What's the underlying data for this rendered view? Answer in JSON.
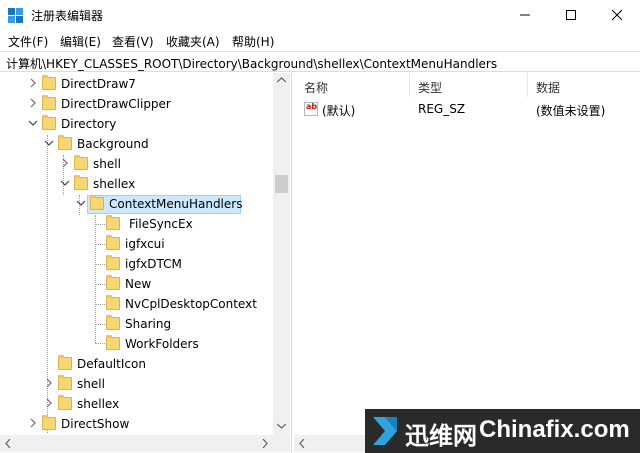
{
  "window": {
    "title": "注册表编辑器",
    "controls": {
      "minimize": "minimize-icon",
      "maximize": "maximize-icon",
      "close": "close-icon"
    }
  },
  "menu": [
    "文件(F)",
    "编辑(E)",
    "查看(V)",
    "收藏夹(A)",
    "帮助(H)"
  ],
  "address": "计算机\\HKEY_CLASSES_ROOT\\Directory\\Background\\shellex\\ContextMenuHandlers",
  "tree": [
    {
      "label": "DirectDraw7",
      "state": "collapsed"
    },
    {
      "label": "DirectDrawClipper",
      "state": "collapsed"
    },
    {
      "label": "Directory",
      "state": "expanded"
    },
    {
      "label": "Background",
      "state": "expanded"
    },
    {
      "label": "shell",
      "state": "collapsed"
    },
    {
      "label": "shellex",
      "state": "expanded"
    },
    {
      "label": "ContextMenuHandlers",
      "state": "expanded",
      "selected": true
    },
    {
      "label": "FileSyncEx",
      "state": "leaf"
    },
    {
      "label": "igfxcui",
      "state": "leaf"
    },
    {
      "label": "igfxDTCM",
      "state": "leaf"
    },
    {
      "label": "New",
      "state": "leaf"
    },
    {
      "label": "NvCplDesktopContext",
      "state": "leaf"
    },
    {
      "label": "Sharing",
      "state": "leaf"
    },
    {
      "label": "WorkFolders",
      "state": "leaf"
    },
    {
      "label": "DefaultIcon",
      "state": "leaf"
    },
    {
      "label": "shell",
      "state": "collapsed"
    },
    {
      "label": "shellex",
      "state": "collapsed"
    },
    {
      "label": "DirectShow",
      "state": "collapsed"
    }
  ],
  "columns": {
    "name": "名称",
    "type": "类型",
    "data": "数据"
  },
  "values": [
    {
      "icon": "ab",
      "name": "(默认)",
      "type": "REG_SZ",
      "data": "(数值未设置)"
    }
  ],
  "watermark": {
    "cn": "迅维网",
    "en": "Chinafix.com"
  },
  "colors": {
    "selection": "#cce8ff",
    "folder": "#f7d774",
    "watermark_bg": "#2a2a2a"
  }
}
